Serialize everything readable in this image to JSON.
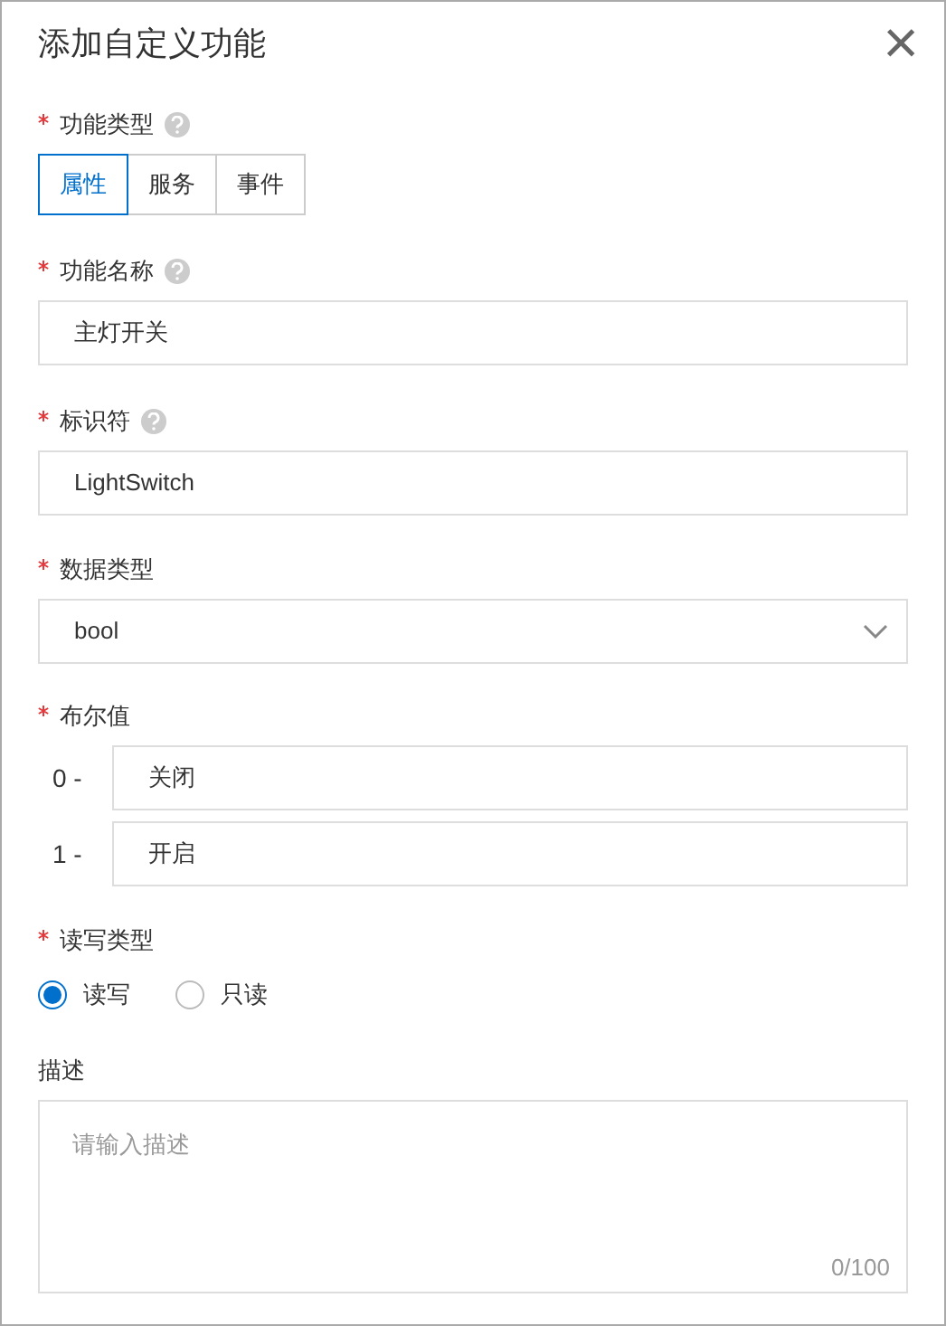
{
  "dialog": {
    "title": "添加自定义功能",
    "close": "×"
  },
  "fields": [
    {
      "kind": "segmented",
      "label": "功能类型",
      "required": true,
      "help": true,
      "options": [
        {
          "label": "属性",
          "selected": true
        },
        {
          "label": "服务",
          "selected": false
        },
        {
          "label": "事件",
          "selected": false
        }
      ]
    },
    {
      "kind": "text",
      "label": "功能名称",
      "required": true,
      "help": true,
      "value": "主灯开关"
    },
    {
      "kind": "text",
      "label": "标识符",
      "required": true,
      "help": true,
      "value": "LightSwitch"
    },
    {
      "kind": "select",
      "label": "数据类型",
      "required": true,
      "help": false,
      "value": "bool"
    },
    {
      "kind": "bool",
      "label": "布尔值",
      "required": true,
      "help": false,
      "rows": [
        {
          "prefix": "0 -",
          "value": "关闭"
        },
        {
          "prefix": "1 -",
          "value": "开启"
        }
      ]
    },
    {
      "kind": "radio",
      "label": "读写类型",
      "required": true,
      "help": false,
      "options": [
        {
          "label": "读写",
          "selected": true
        },
        {
          "label": "只读",
          "selected": false
        }
      ]
    },
    {
      "kind": "textarea",
      "label": "描述",
      "required": false,
      "help": false,
      "placeholder": "请输入描述",
      "counter": "0/100"
    }
  ]
}
